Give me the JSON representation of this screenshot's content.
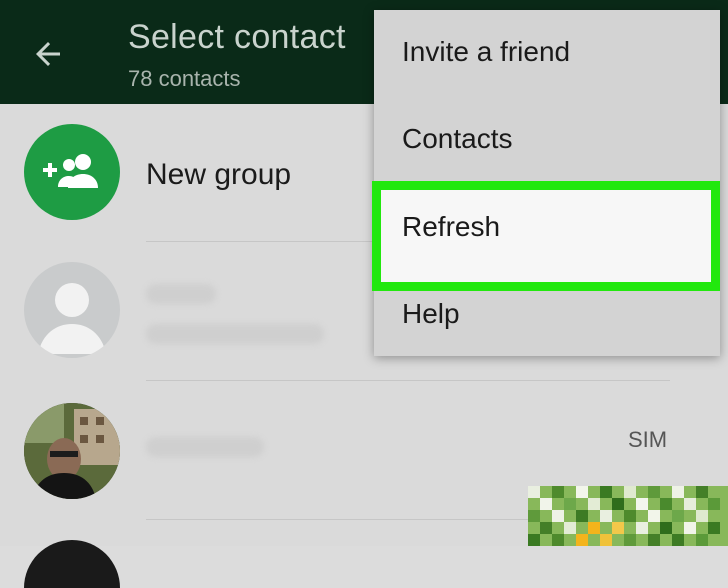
{
  "header": {
    "title": "Select contact",
    "subtitle": "78 contacts"
  },
  "list": {
    "new_group_label": "New group",
    "sim_badge": "SIM"
  },
  "menu": {
    "items": [
      {
        "label": "Invite a friend"
      },
      {
        "label": "Contacts"
      },
      {
        "label": "Refresh",
        "highlighted": true
      },
      {
        "label": "Help"
      }
    ]
  },
  "colors": {
    "header_bg": "#0a2a18",
    "accent_green": "#1e9c44",
    "highlight_outline": "#22e80e"
  }
}
